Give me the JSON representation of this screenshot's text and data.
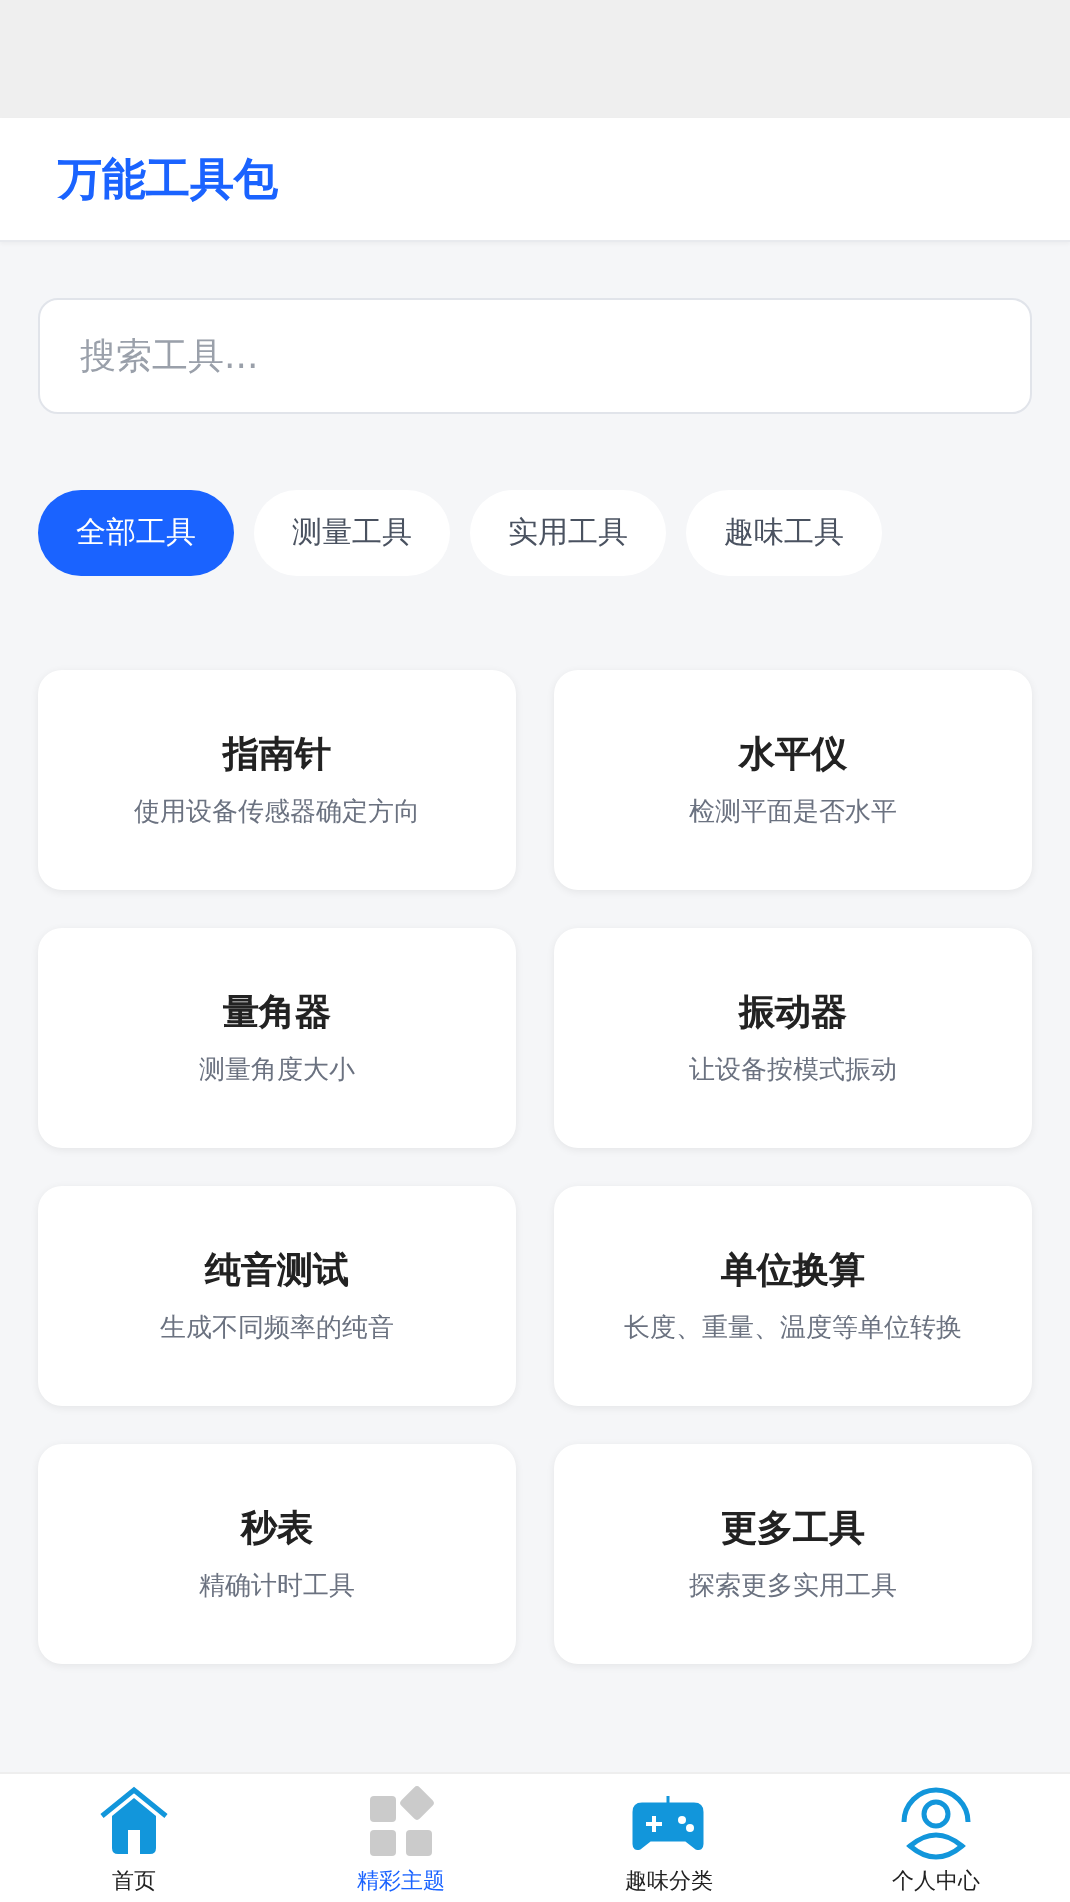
{
  "header": {
    "title": "万能工具包"
  },
  "search": {
    "placeholder": "搜索工具..."
  },
  "categories": [
    {
      "label": "全部工具",
      "selected": true
    },
    {
      "label": "测量工具",
      "selected": false
    },
    {
      "label": "实用工具",
      "selected": false
    },
    {
      "label": "趣味工具",
      "selected": false
    }
  ],
  "tools": [
    {
      "name": "指南针",
      "description": "使用设备传感器确定方向"
    },
    {
      "name": "水平仪",
      "description": "检测平面是否水平"
    },
    {
      "name": "量角器",
      "description": "测量角度大小"
    },
    {
      "name": "振动器",
      "description": "让设备按模式振动"
    },
    {
      "name": "纯音测试",
      "description": "生成不同频率的纯音"
    },
    {
      "name": "单位换算",
      "description": "长度、重量、温度等单位转换"
    },
    {
      "name": "秒表",
      "description": "精确计时工具"
    },
    {
      "name": "更多工具",
      "description": "探索更多实用工具"
    }
  ],
  "bottom_nav": [
    {
      "kind": "home",
      "label": "首页",
      "selected": false
    },
    {
      "kind": "themes",
      "label": "精彩主题",
      "selected": true
    },
    {
      "kind": "games",
      "label": "趣味分类",
      "selected": false
    },
    {
      "kind": "profile",
      "label": "个人中心",
      "selected": false
    }
  ]
}
